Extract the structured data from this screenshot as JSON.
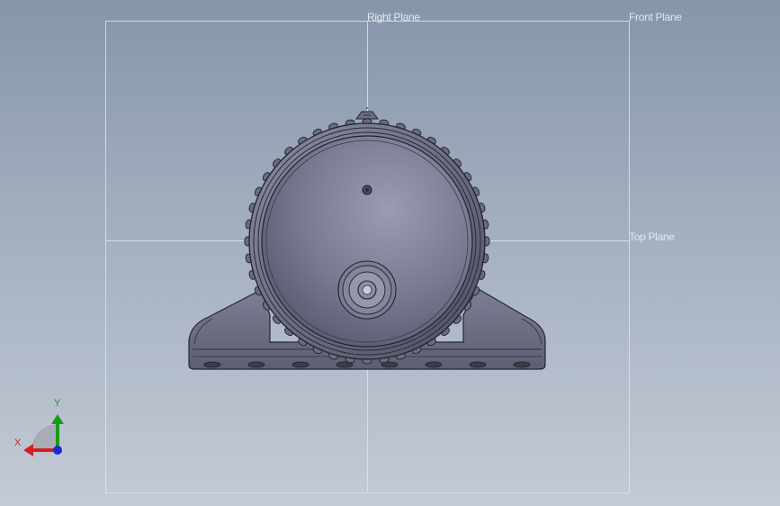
{
  "viewport": {
    "planes": {
      "right": "Right Plane",
      "front": "Front Plane",
      "top": "Top Plane"
    },
    "triad": {
      "x_label": "X",
      "y_label": "Y",
      "x_color": "#d42020",
      "y_color": "#1a9a1a",
      "z_color": "#1c2ad0"
    },
    "model": {
      "body_color": "#6b6d82",
      "edge_color": "#25262e"
    }
  }
}
